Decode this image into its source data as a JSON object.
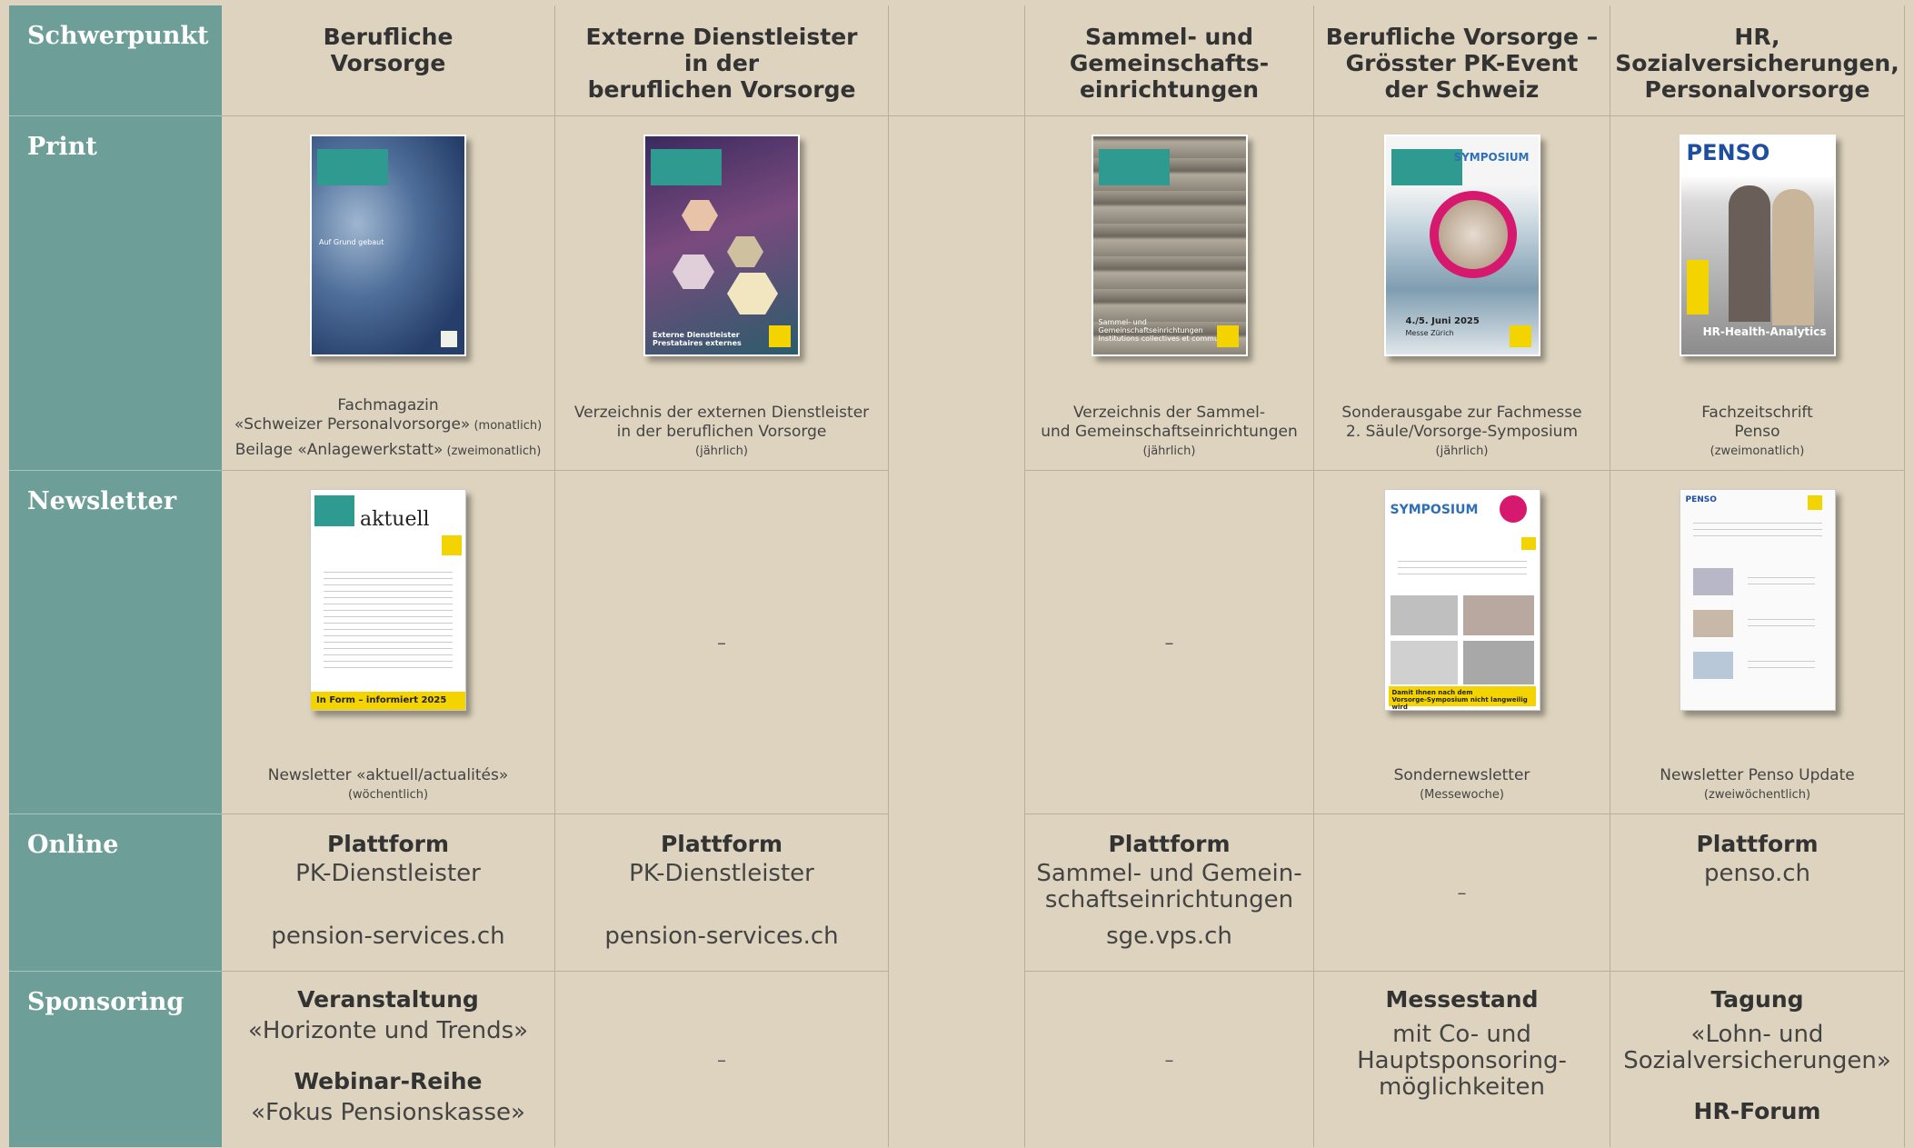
{
  "columns": [
    "Schwerpunkt",
    "Berufliche\nVorsorge",
    "Externe Dienstleister\nin der\nberuflichen Vorsorge",
    "Sammel- und\nGemeinschafts-\neinrichtungen",
    "Berufliche Vorsorge –\nGrösster PK-Event\nder Schweiz",
    "HR,\nSozialversicherungen,\nPersonalvorsorge"
  ],
  "rows": {
    "print": "Print",
    "newsletter": "Newsletter",
    "online": "Online",
    "sponsoring": "Sponsoring"
  },
  "dash": "–",
  "print": {
    "bv": {
      "l1": "Fachmagazin",
      "l2": "«Schweizer Personalvorsorge»",
      "l2s": " (monatlich)",
      "l3": "Beilage «Anlagewerkstatt»",
      "l3s": " (zweimonatlich)"
    },
    "ext": {
      "l1": "Verzeichnis der externen Dienstleister",
      "l2": "in der beruflichen Vorsorge",
      "l3": "(jährlich)"
    },
    "sge": {
      "l1": "Verzeichnis der Sammel-",
      "l2": "und Gemeinschaftseinrichtungen",
      "l3": "(jährlich)"
    },
    "event": {
      "l1": "Sonderausgabe zur Fachmesse",
      "l2": "2. Säule/Vorsorge-Symposium",
      "l3": "(jährlich)"
    },
    "hr": {
      "l1": "Fachzeitschrift",
      "l2": "Penso",
      "l3": "(zweimonatlich)"
    }
  },
  "covers": {
    "bv_text": "Auf Grund gebaut",
    "ext_text": "Externe Dienstleister\nPrestataires externes",
    "sge_text": "Sammel- und Gemeinschaftseinrichtungen\nInstitutions collectives et communes",
    "event_symposium": "SYMPOSIUM",
    "event_date": "4./5. Juni 2025",
    "event_place": "Messe Zürich",
    "penso_logo": "PENSO",
    "penso_tag": "HR-Health-Analytics",
    "nl_aktuell": "aktuell",
    "nl_form": "In Form – informiert 2025",
    "nl2_symposium": "SYMPOSIUM",
    "nl2_footer": "Damit Ihnen nach dem\nVorsorge-Symposium nicht langweilig wird",
    "nl3_logo": "PENSO"
  },
  "newsletter": {
    "bv": {
      "l1": "Newsletter «aktuell/actualités»",
      "l2": "(wöchentlich)"
    },
    "event": {
      "l1": "Sondernewsletter",
      "l2": "(Messewoche)"
    },
    "hr": {
      "l1": "Newsletter Penso Update",
      "l2": "(zweiwöchentlich)"
    }
  },
  "online": {
    "bv": {
      "title": "Plattform",
      "name": "PK-Dienstleister",
      "url": "pension-services.ch"
    },
    "ext": {
      "title": "Plattform",
      "name": "PK-Dienstleister",
      "url": "pension-services.ch"
    },
    "sge": {
      "title": "Plattform",
      "name": "Sammel- und Gemein-\nschaftseinrichtungen",
      "url": "sge.vps.ch"
    },
    "hr": {
      "title": "Plattform",
      "url": "penso.ch"
    }
  },
  "sponsoring": {
    "bv": {
      "t1": "Veranstaltung",
      "s1": "«Horizonte und Trends»",
      "t2": "Webinar-Reihe",
      "s2": "«Fokus Pensionskasse»"
    },
    "event": {
      "t1": "Messestand",
      "s1": "mit Co- und\nHauptsponsoring-\nmöglichkeiten"
    },
    "hr": {
      "t1": "Tagung",
      "s1": "«Lohn- und\nSozialversicherungen»",
      "t2": "HR-Forum"
    }
  },
  "colors": {
    "label_bg": "#6e9e98",
    "page_bg": "#ddd3be",
    "teal": "#2f9a8f",
    "yellow": "#f4d400",
    "magenta": "#d6196e"
  }
}
